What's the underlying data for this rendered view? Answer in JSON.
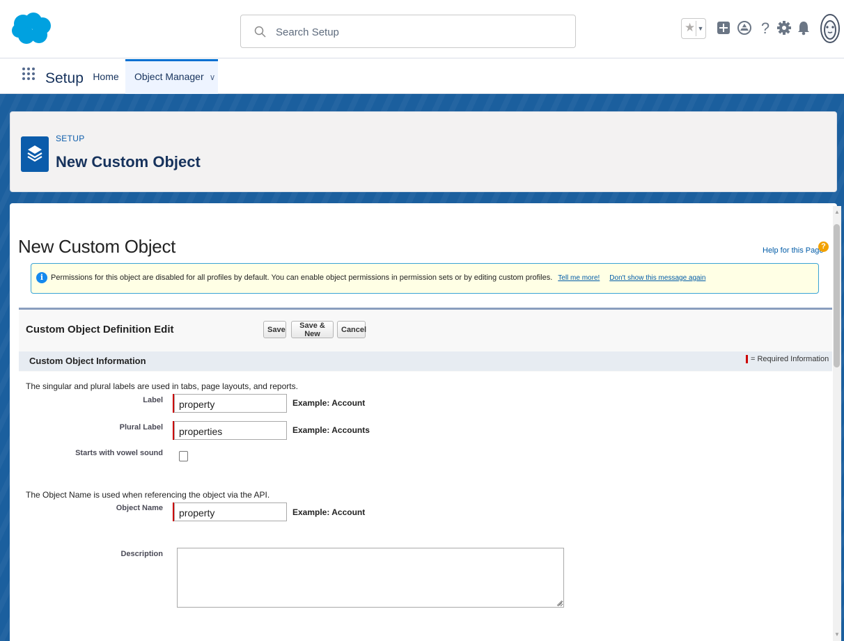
{
  "search": {
    "placeholder": "Search Setup"
  },
  "nav": {
    "app_name": "Setup",
    "tabs": [
      {
        "label": "Home"
      },
      {
        "label": "Object Manager"
      }
    ]
  },
  "page_header": {
    "kicker": "SETUP",
    "title": "New Custom Object"
  },
  "content": {
    "title": "New Custom Object",
    "help_link": "Help for this Page",
    "info_message": {
      "text": "Permissions for this object are disabled for all profiles by default. You can enable object permissions in permission sets or by editing custom profiles.",
      "tell_me_more": "Tell me more!",
      "dont_show": "Don't show this message again"
    }
  },
  "form": {
    "block_title": "Custom Object Definition Edit",
    "buttons": {
      "save": "Save",
      "save_new": "Save & New",
      "cancel": "Cancel"
    },
    "section_title": "Custom Object Information",
    "required_legend": "= Required Information",
    "labels_help": "The singular and plural labels are used in tabs, page layouts, and reports.",
    "label": {
      "label": "Label",
      "value": "property",
      "example": "Example:  Account"
    },
    "plural_label": {
      "label": "Plural Label",
      "value": "properties",
      "example": "Example:  Accounts"
    },
    "vowel": {
      "label": "Starts with vowel sound",
      "checked": false
    },
    "api_help": "The Object Name is used when referencing the object via the API.",
    "object_name": {
      "label": "Object Name",
      "value": "property",
      "example": "Example:  Account"
    },
    "description": {
      "label": "Description",
      "value": ""
    }
  },
  "colors": {
    "brand": "#00a1e0",
    "banner": "#1b5f9e",
    "setup_icon": "#0b5cab",
    "required": "#cc0000",
    "info_border": "#39a3d5"
  },
  "icons": [
    "salesforce-cloud-logo",
    "search-icon",
    "favorites-star-icon",
    "add-icon",
    "trailhead-icon",
    "help-icon",
    "gear-icon",
    "bell-icon",
    "avatar",
    "app-launcher-icon",
    "layers-icon",
    "info-icon"
  ]
}
